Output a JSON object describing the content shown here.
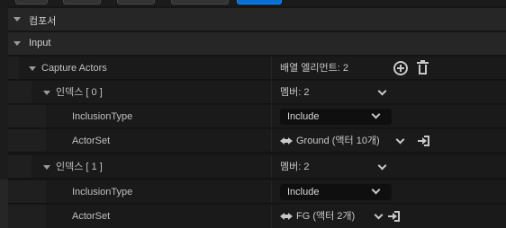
{
  "categories": {
    "component": "컴포서",
    "input": "Input"
  },
  "capture_actors": {
    "label": "Capture Actors",
    "value": "배열 엘리먼트: 2"
  },
  "elements": [
    {
      "label": "인덱스 [ 0 ]",
      "members": "멤버: 2",
      "inclusion_label": "InclusionType",
      "inclusion_value": "Include",
      "actorset_label": "ActorSet",
      "actorset_value": "Ground (액터 10개)"
    },
    {
      "label": "인덱스 [ 1 ]",
      "members": "멤버: 2",
      "inclusion_label": "InclusionType",
      "inclusion_value": "Include",
      "actorset_label": "ActorSet",
      "actorset_value": "FG (액터 2개)"
    }
  ],
  "colors": {
    "accent": "#0a6fd0"
  }
}
